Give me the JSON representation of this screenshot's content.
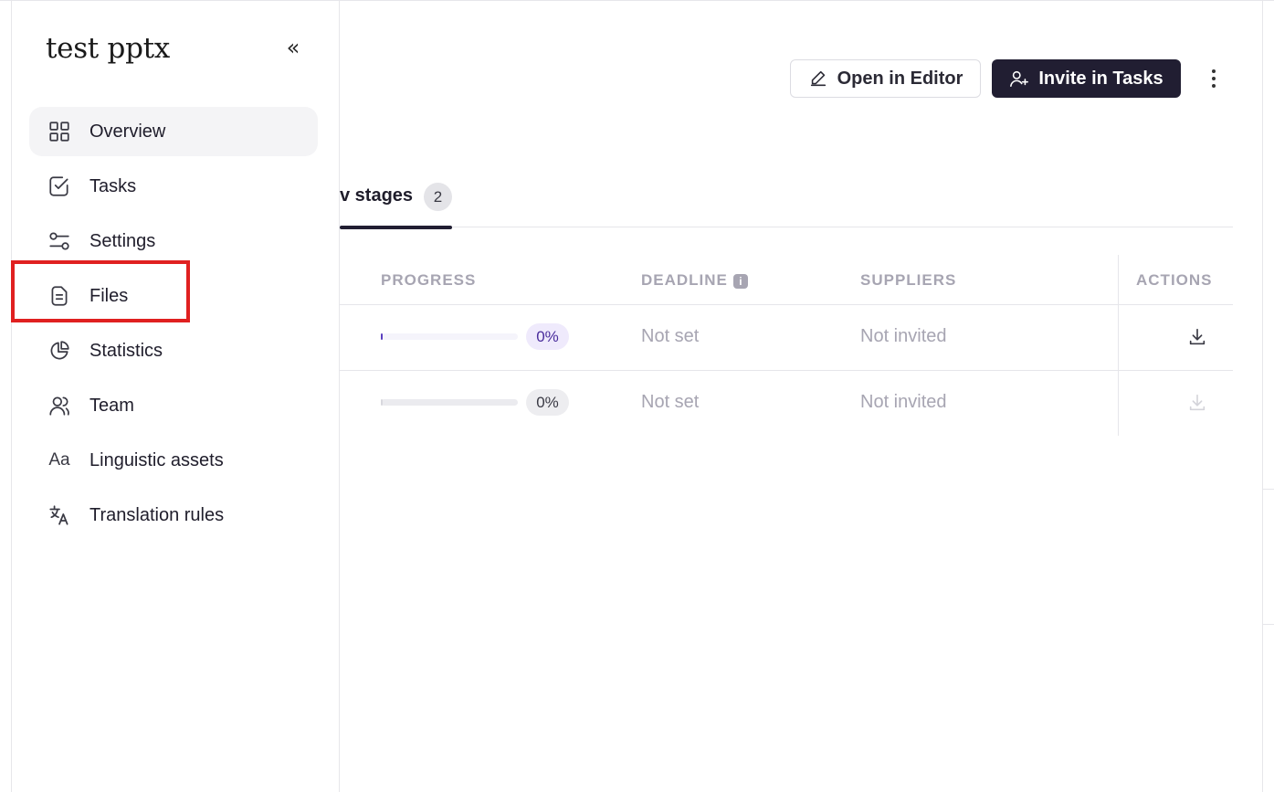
{
  "sidebar": {
    "project_title": "test pptx",
    "collapse_glyph": "«",
    "items": [
      {
        "label": "Overview",
        "icon": "grid-icon",
        "active": true
      },
      {
        "label": "Tasks",
        "icon": "check-square-icon"
      },
      {
        "label": "Settings",
        "icon": "sliders-icon"
      },
      {
        "label": "Files",
        "icon": "file-icon"
      },
      {
        "label": "Statistics",
        "icon": "pie-chart-icon"
      },
      {
        "label": "Team",
        "icon": "users-icon"
      },
      {
        "label": "Linguistic assets",
        "icon": "aa-icon",
        "glyph": "Aa"
      },
      {
        "label": "Translation rules",
        "icon": "translate-icon"
      }
    ]
  },
  "toolbar": {
    "open_editor_label": "Open in Editor",
    "invite_label": "Invite in Tasks"
  },
  "tabs": {
    "stages_label": "v stages",
    "stages_count": "2"
  },
  "table": {
    "headers": {
      "progress": "PROGRESS",
      "deadline": "DEADLINE",
      "suppliers": "SUPPLIERS",
      "actions": "ACTIONS"
    },
    "deadline_info_glyph": "i",
    "rows": [
      {
        "progress": 0.0,
        "progress_label": "0%",
        "deadline": "Not set",
        "suppliers": "Not invited",
        "download_enabled": true
      },
      {
        "progress": 0.0,
        "progress_label": "0%",
        "deadline": "Not set",
        "suppliers": "Not invited",
        "download_enabled": false
      }
    ]
  },
  "colors": {
    "accent_dark": "#211e32",
    "highlight_box": "#e02020",
    "progress_purple": "#5a3fc0"
  }
}
